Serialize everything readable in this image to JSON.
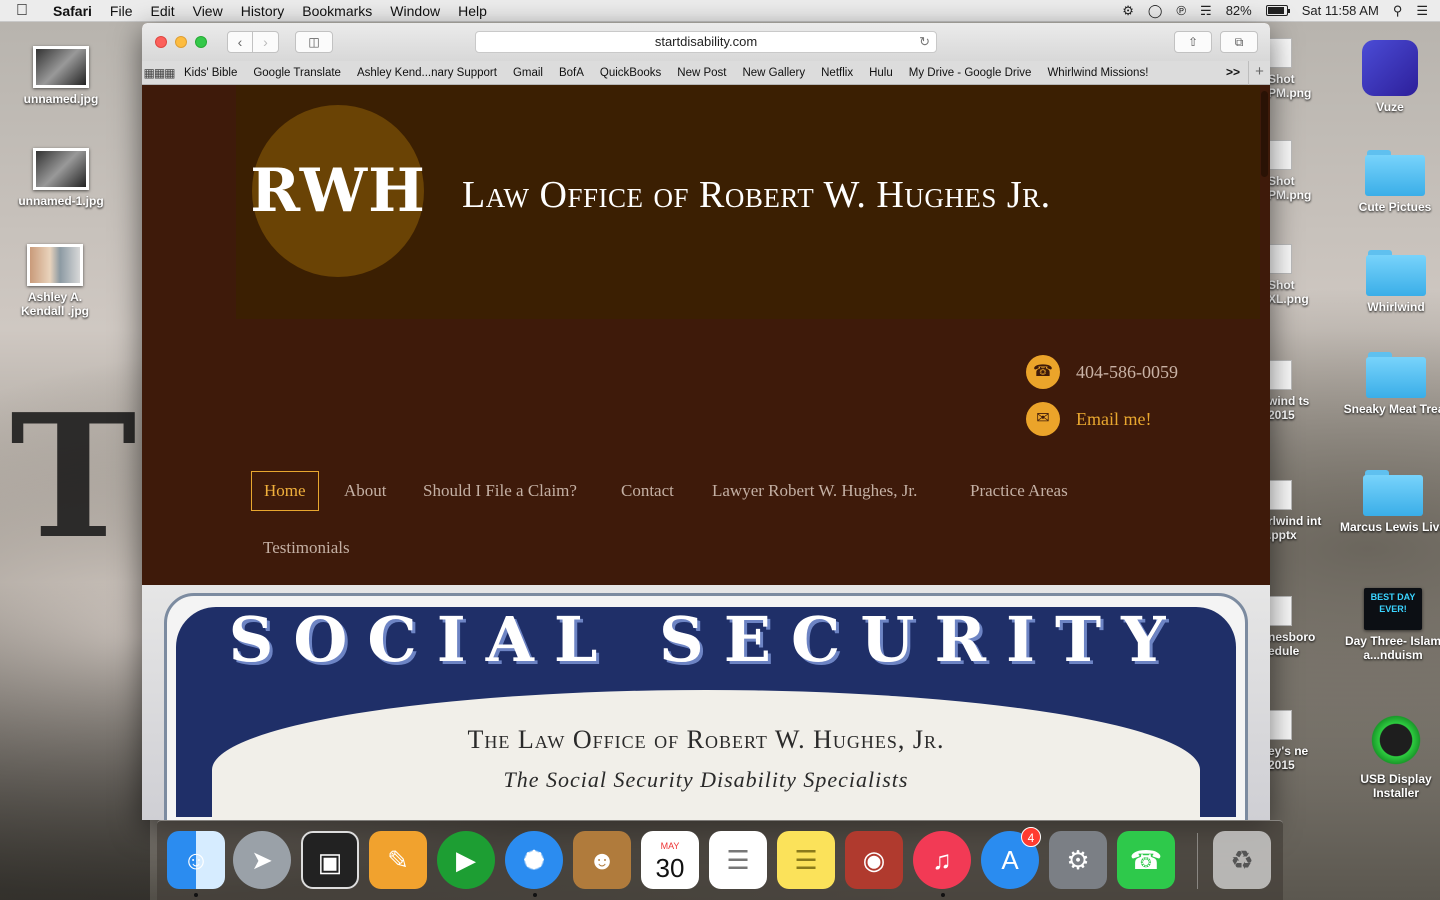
{
  "menubar": {
    "app_name": "Safari",
    "menus": [
      "File",
      "Edit",
      "View",
      "History",
      "Bookmarks",
      "Window",
      "Help"
    ],
    "battery": "82%",
    "clock": "Sat 11:58 AM"
  },
  "desktop_left": [
    {
      "label": "unnamed.jpg"
    },
    {
      "label": "unnamed-1.jpg"
    },
    {
      "label": "Ashley A. Kendall .jpg"
    }
  ],
  "desktop_right": [
    {
      "label": "Vuze"
    },
    {
      "label": "Cute Pictues"
    },
    {
      "label": "Whirlwind"
    },
    {
      "label": "Sneaky Meat Treat"
    },
    {
      "label": "Marcus Lewis Live"
    },
    {
      "label": "Day Three- Islam a...nduism"
    },
    {
      "label": "USB Display Installer"
    }
  ],
  "desktop_partial": [
    {
      "label": "Shot PM.png"
    },
    {
      "label": "Shot PM.png"
    },
    {
      "label": "Shot XL.png"
    },
    {
      "label": "wind ts 2015"
    },
    {
      "label": "rlwind int .pptx"
    },
    {
      "label": "nesboro edule"
    },
    {
      "label": "ey's ne 2015"
    }
  ],
  "day_three_thumb": "BEST DAY EVER!",
  "browser": {
    "url": "startdisability.com",
    "favorites": [
      "Kids' Bible",
      "Google Translate",
      "Ashley Kend...nary Support",
      "Gmail",
      "BofA",
      "QuickBooks",
      "New Post",
      "New Gallery",
      "Netflix",
      "Hulu",
      "My Drive - Google Drive",
      "Whirlwind Missions!"
    ]
  },
  "site": {
    "logo_text": "RWH",
    "title": "Law Office of Robert W. Hughes Jr.",
    "phone": "404-586-0059",
    "email_label": "Email me!",
    "nav": [
      "Home",
      "About",
      "Should I File a Claim?",
      "Contact",
      "Lawyer Robert W. Hughes, Jr.",
      "Practice Areas",
      "Testimonials"
    ],
    "banner_title": "SOCIAL SECURITY",
    "banner_line1": "The Law Office of Robert W. Hughes, Jr.",
    "banner_line2": "The Social Security Disability Specialists"
  },
  "dock": {
    "apps": [
      "Finder",
      "Launchpad",
      "Photo Booth",
      "Pages",
      "USB Display",
      "Safari",
      "Contacts",
      "Calendar",
      "Reminders",
      "Notes",
      "Photos",
      "iTunes",
      "App Store",
      "System Preferences",
      "FaceTime",
      "Trash"
    ],
    "calendar_month": "MAY",
    "calendar_day": "30",
    "app_store_badge": "4"
  }
}
